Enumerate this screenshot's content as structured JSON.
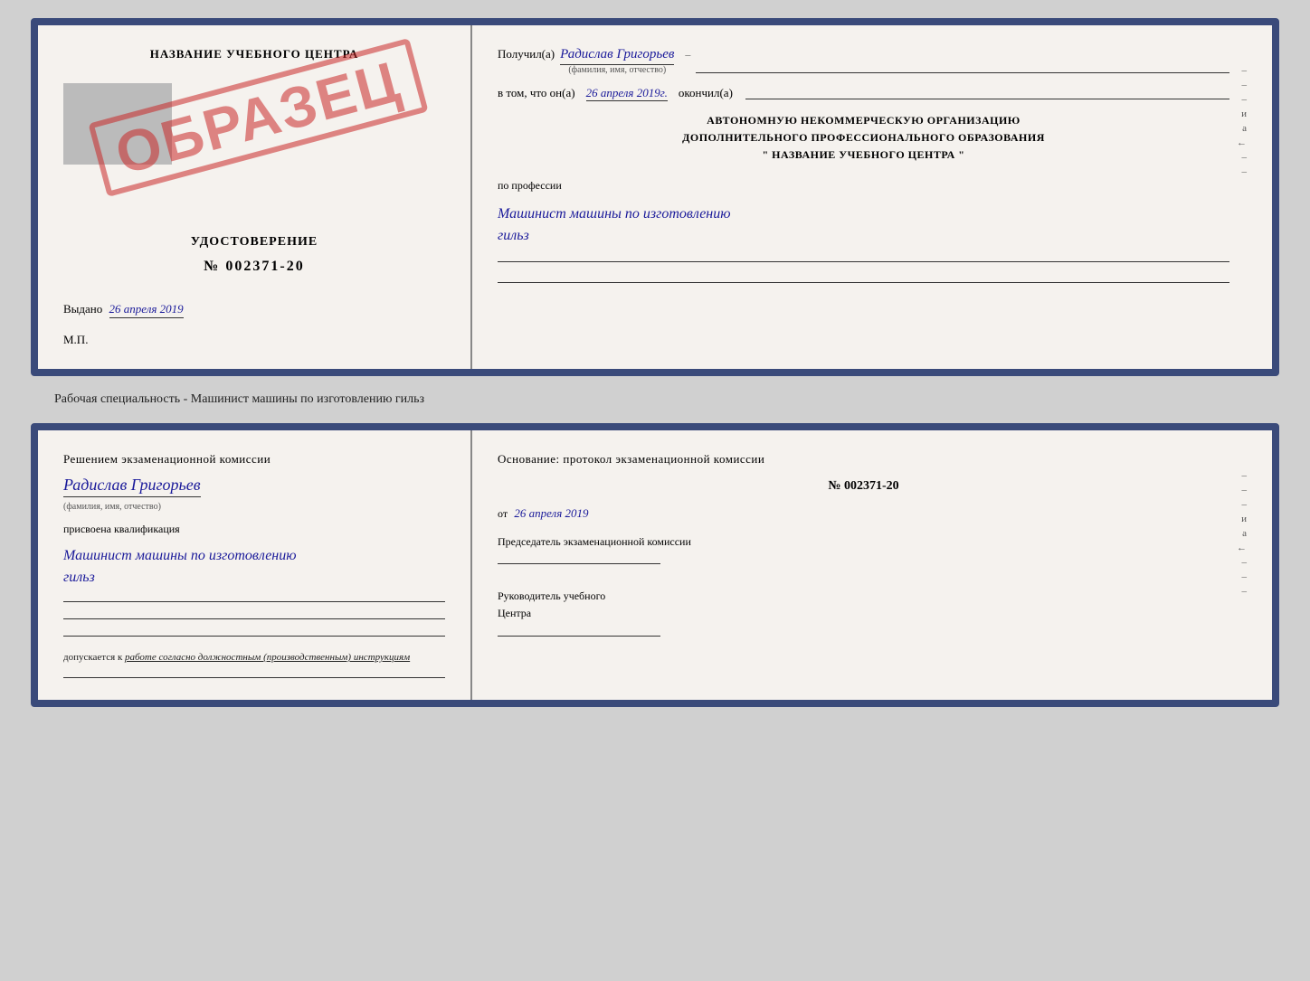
{
  "top_card": {
    "left": {
      "center_name": "НАЗВАНИЕ УЧЕБНОГО ЦЕНТРА",
      "stamp_text": "ОБРАЗЕЦ",
      "cert_type": "УДОСТОВЕРЕНИЕ",
      "cert_number": "№ 002371-20",
      "issue_prefix": "Выдано",
      "issue_date": "26 апреля 2019",
      "mp_label": "М.П."
    },
    "right": {
      "received_prefix": "Получил(а)",
      "received_name": "Радислав Григорьев",
      "name_subtitle": "(фамилия, имя, отчество)",
      "dash": "–",
      "date_prefix": "в том, что он(а)",
      "date_value": "26 апреля 2019г.",
      "date_suffix": "окончил(а)",
      "org_line1": "АВТОНОМНУЮ НЕКОММЕРЧЕСКУЮ ОРГАНИЗАЦИЮ",
      "org_line2": "ДОПОЛНИТЕЛЬНОГО ПРОФЕССИОНАЛЬНОГО ОБРАЗОВАНИЯ",
      "org_line3": "\" НАЗВАНИЕ УЧЕБНОГО ЦЕНТРА \"",
      "profession_label": "по профессии",
      "profession_value1": "Машинист машины по изготовлению",
      "profession_value2": "гильз",
      "margin_marks": [
        "–",
        "–",
        "и",
        "а",
        "←",
        "–",
        "–"
      ]
    }
  },
  "specialty_label": "Рабочая специальность - Машинист машины по изготовлению гильз",
  "bottom_card": {
    "left": {
      "commission_text": "Решением  экзаменационной  комиссии",
      "person_name": "Радислав Григорьев",
      "name_subtitle": "(фамилия, имя, отчество)",
      "qualification_prefix": "присвоена квалификация",
      "qualification_value1": "Машинист  машины  по  изготовлению",
      "qualification_value2": "гильз",
      "admission_text": "допускается к  работе согласно должностным (производственным) инструкциям"
    },
    "right": {
      "basis_text": "Основание:  протокол  экзаменационной  комиссии",
      "protocol_number": "№  002371-20",
      "date_prefix": "от",
      "date_value": "26 апреля 2019",
      "chairman_label": "Председатель экзаменационной комиссии",
      "director_label1": "Руководитель учебного",
      "director_label2": "Центра",
      "margin_marks": [
        "–",
        "–",
        "–",
        "и",
        "а",
        "←",
        "–",
        "–",
        "–"
      ]
    }
  }
}
